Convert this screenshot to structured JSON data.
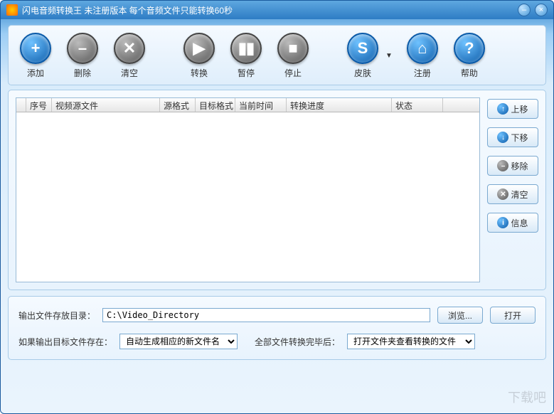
{
  "titlebar": {
    "title": "闪电音频转换王  未注册版本 每个音频文件只能转换60秒"
  },
  "toolbar": {
    "add": "添加",
    "remove": "删除",
    "clear": "清空",
    "convert": "转换",
    "pause": "暂停",
    "stop": "停止",
    "skin": "皮肤",
    "register": "注册",
    "help": "帮助"
  },
  "table": {
    "columns": {
      "col0": "",
      "col1": "序号",
      "col2": "视频源文件",
      "col3": "源格式",
      "col4": "目标格式",
      "col5": "当前时间",
      "col6": "转换进度",
      "col7": "状态",
      "col8": ""
    }
  },
  "sidebar": {
    "move_up": "上移",
    "move_down": "下移",
    "remove": "移除",
    "clear": "清空",
    "info": "信息"
  },
  "output": {
    "dir_label": "输出文件存放目录：",
    "dir_value": "C:\\Video_Directory",
    "browse": "浏览...",
    "open": "打开",
    "exists_label": "如果输出目标文件存在：",
    "exists_value": "自动生成相应的新文件名",
    "after_label": "全部文件转换完毕后：",
    "after_value": "打开文件夹查看转换的文件"
  },
  "watermark": "下载吧"
}
